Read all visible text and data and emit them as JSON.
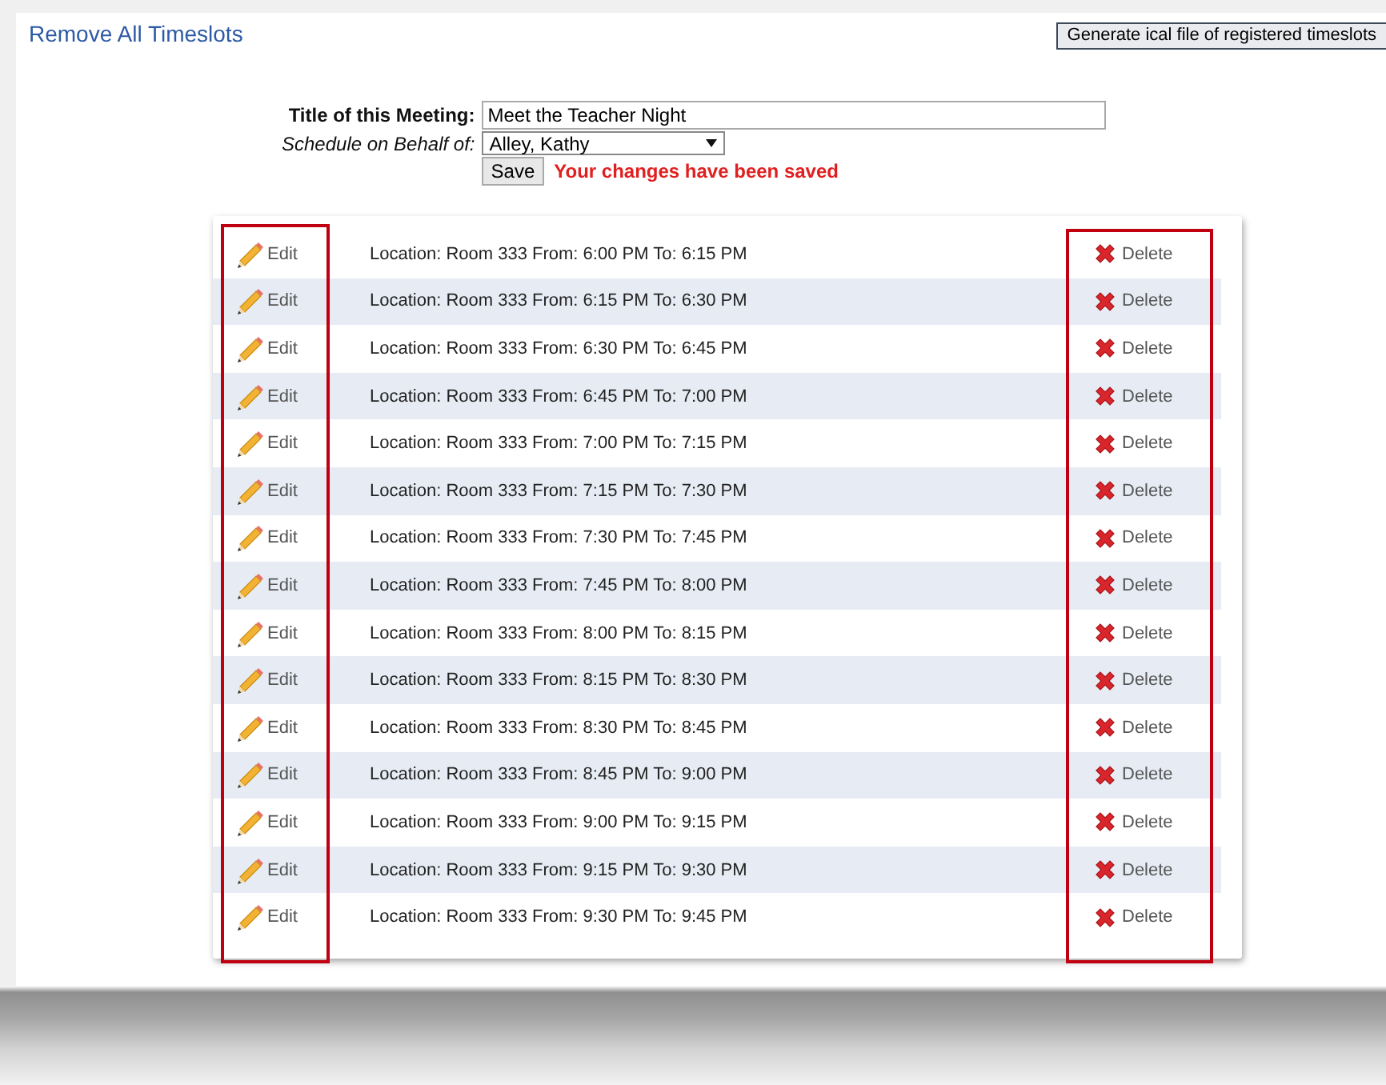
{
  "remove_all_link": "Remove All Timeslots",
  "ical_button": "Generate ical file of registered timeslots",
  "form": {
    "title_label": "Title of this Meeting:",
    "title_value": "Meet the Teacher Night",
    "behalf_label": "Schedule on Behalf of:",
    "behalf_value": "Alley, Kathy",
    "save_button": "Save",
    "saved_message": "Your changes have been saved"
  },
  "timeslots": [
    {
      "edit": "Edit",
      "text": "Location: Room 333 From: 6:00 PM To: 6:15 PM",
      "delete": "Delete"
    },
    {
      "edit": "Edit",
      "text": "Location: Room 333 From: 6:15 PM To: 6:30 PM",
      "delete": "Delete"
    },
    {
      "edit": "Edit",
      "text": "Location: Room 333 From: 6:30 PM To: 6:45 PM",
      "delete": "Delete"
    },
    {
      "edit": "Edit",
      "text": "Location: Room 333 From: 6:45 PM To: 7:00 PM",
      "delete": "Delete"
    },
    {
      "edit": "Edit",
      "text": "Location: Room 333 From: 7:00 PM To: 7:15 PM",
      "delete": "Delete"
    },
    {
      "edit": "Edit",
      "text": "Location: Room 333 From: 7:15 PM To: 7:30 PM",
      "delete": "Delete"
    },
    {
      "edit": "Edit",
      "text": "Location: Room 333 From: 7:30 PM To: 7:45 PM",
      "delete": "Delete"
    },
    {
      "edit": "Edit",
      "text": "Location: Room 333 From: 7:45 PM To: 8:00 PM",
      "delete": "Delete"
    },
    {
      "edit": "Edit",
      "text": "Location: Room 333 From: 8:00 PM To: 8:15 PM",
      "delete": "Delete"
    },
    {
      "edit": "Edit",
      "text": "Location: Room 333 From: 8:15 PM To: 8:30 PM",
      "delete": "Delete"
    },
    {
      "edit": "Edit",
      "text": "Location: Room 333 From: 8:30 PM To: 8:45 PM",
      "delete": "Delete"
    },
    {
      "edit": "Edit",
      "text": "Location: Room 333 From: 8:45 PM To: 9:00 PM",
      "delete": "Delete"
    },
    {
      "edit": "Edit",
      "text": "Location: Room 333 From: 9:00 PM To: 9:15 PM",
      "delete": "Delete"
    },
    {
      "edit": "Edit",
      "text": "Location: Room 333 From: 9:15 PM To: 9:30 PM",
      "delete": "Delete"
    },
    {
      "edit": "Edit",
      "text": "Location: Room 333 From: 9:30 PM To: 9:45 PM",
      "delete": "Delete"
    }
  ]
}
